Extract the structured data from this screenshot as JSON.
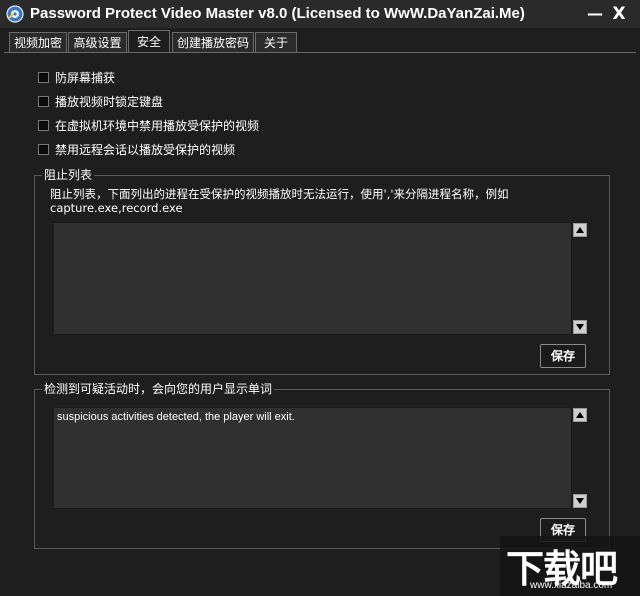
{
  "window": {
    "title": "Password Protect Video Master v8.0 (Licensed to WwW.DaYanZai.Me)",
    "minimize_label": "—",
    "close_label": "X"
  },
  "tabs": [
    {
      "label": "视频加密",
      "active": false
    },
    {
      "label": "高级设置",
      "active": false
    },
    {
      "label": "安全",
      "active": true
    },
    {
      "label": "创建播放密码",
      "active": false
    },
    {
      "label": "关于",
      "active": false
    }
  ],
  "options": [
    {
      "label": "防屏幕捕获"
    },
    {
      "label": "播放视频时锁定键盘"
    },
    {
      "label": "在虚拟机环境中禁用播放受保护的视频"
    },
    {
      "label": "禁用远程会话以播放受保护的视频"
    }
  ],
  "block_list": {
    "title": "阻止列表",
    "description_line1": "阻止列表，下面列出的进程在受保护的视频播放时无法运行，使用','来分隔进程名称，例如",
    "description_line2": "capture.exe,record.exe",
    "value": "",
    "save_label": "保存"
  },
  "detection_message": {
    "title": "检测到可疑活动时，会向您的用户显示单词",
    "value": "suspicious activities detected, the player will exit.",
    "save_label": "保存"
  },
  "watermark": {
    "text": "下载吧",
    "url": "www.xiazaiba.com"
  }
}
